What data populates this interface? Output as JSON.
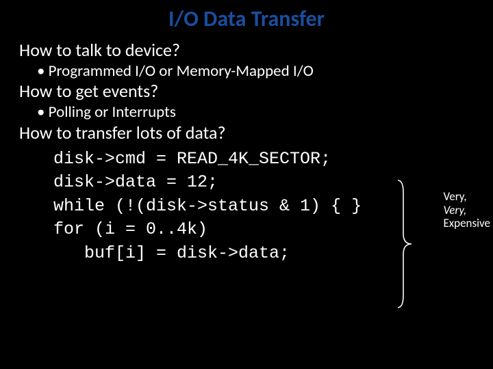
{
  "title": "I/O Data Transfer",
  "q1": "How to talk to device?",
  "b1": "Programmed I/O or Memory-Mapped I/O",
  "q2": "How to get events?",
  "b2": "Polling or Interrupts",
  "q3": "How to transfer lots of data?",
  "code": {
    "l1": "disk->cmd = READ_4K_SECTOR;",
    "l2": "disk->data = 12;",
    "l3": "while (!(disk->status & 1) { }",
    "l4": "for (i = 0..4k)",
    "l5": "   buf[i] = disk->data;"
  },
  "annotation": {
    "l1": "Very,",
    "l2": "Very,",
    "l3": "Expensive"
  }
}
